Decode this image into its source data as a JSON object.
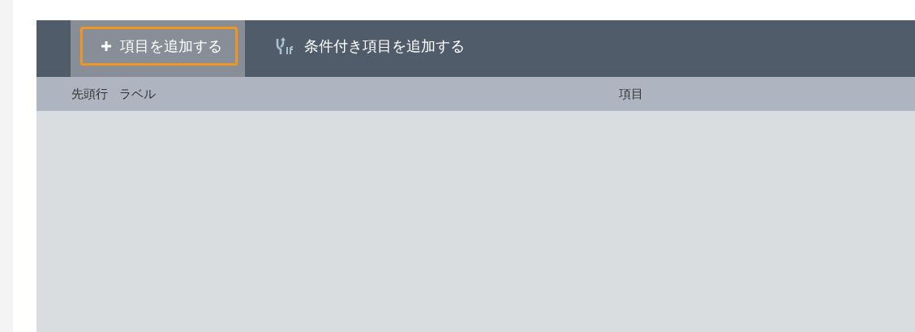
{
  "toolbar": {
    "buttons": [
      {
        "kind": "add",
        "label": "項目を追加する",
        "focused": true
      },
      {
        "kind": "conditional",
        "label": "条件付き項目を追加する",
        "focused": false
      }
    ]
  },
  "table": {
    "columns": [
      "先頭行",
      "ラベル",
      "項目"
    ]
  }
}
